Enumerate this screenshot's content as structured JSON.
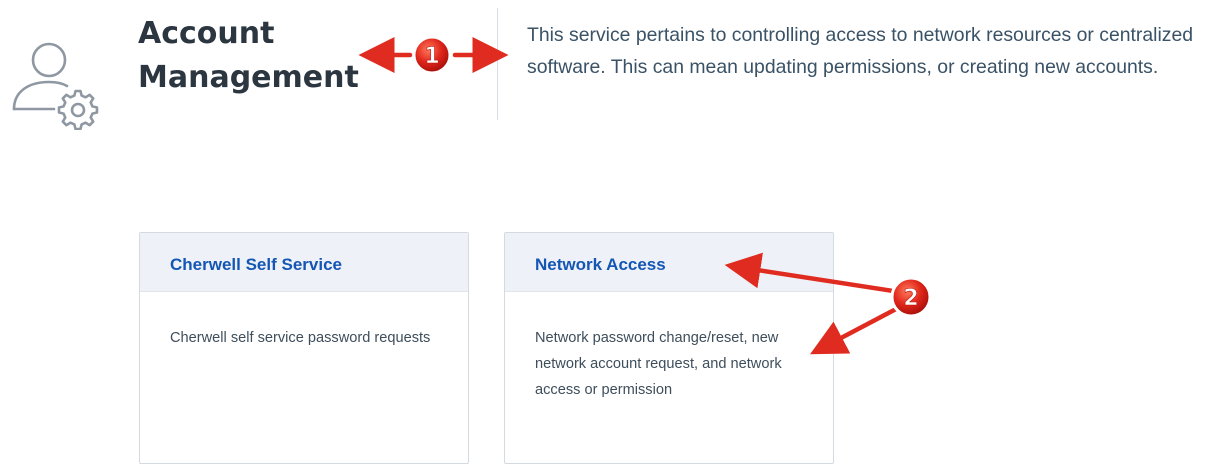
{
  "header": {
    "icon": "user-settings-icon",
    "title": "Account Management",
    "description": "This service pertains to controlling access to network resources or centralized software. This can mean updating permissions, or creating new accounts."
  },
  "cards": [
    {
      "title": "Cherwell Self Service",
      "description": "Cherwell self service password requests"
    },
    {
      "title": "Network Access",
      "description": "Network password change/reset, new network account request, and network access or permission"
    }
  ],
  "annotations": [
    {
      "number": "1"
    },
    {
      "number": "2"
    }
  ],
  "colors": {
    "title": "#2b3640",
    "description": "#3a5266",
    "card_title": "#1456b4",
    "card_header_bg": "#eef1f7",
    "annotation": "#e02b20"
  }
}
